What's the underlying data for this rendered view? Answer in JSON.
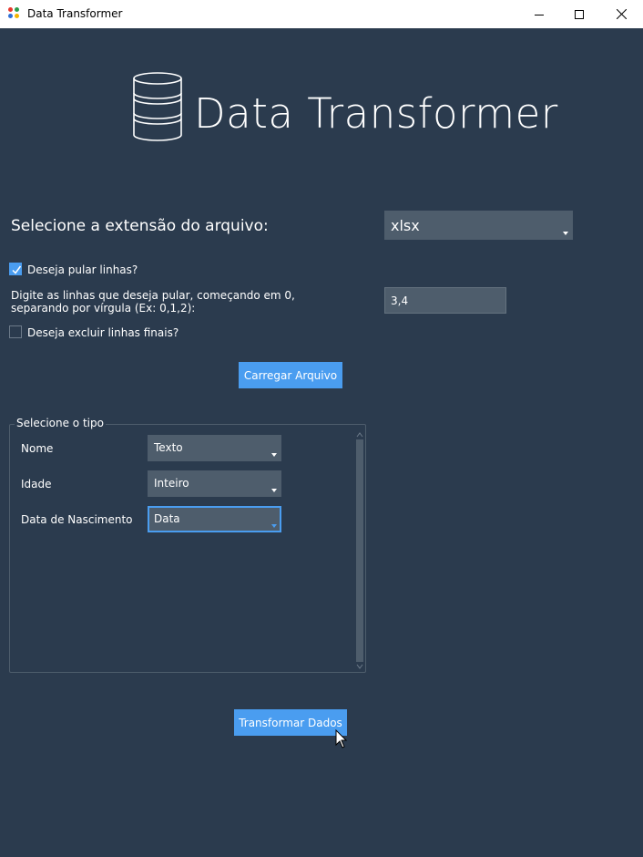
{
  "window": {
    "title": "Data Transformer",
    "minimize_icon": "minimize-icon",
    "maximize_icon": "maximize-icon",
    "close_icon": "close-icon"
  },
  "logo": {
    "icon": "database-icon",
    "title": "Data Transformer"
  },
  "extension": {
    "label": "Selecione a extensão do arquivo:",
    "selected": "xlsx"
  },
  "skip_lines": {
    "label": "Deseja pular linhas?",
    "checked": true,
    "instruction_line1": "Digite as linhas que deseja pular, começando em 0,",
    "instruction_line2": "separando por vírgula (Ex: 0,1,2):",
    "value": "3,4"
  },
  "exclude_final": {
    "label": "Deseja excluir linhas finais?",
    "checked": false
  },
  "load_button": "Carregar Arquivo",
  "types_group": {
    "title": "Selecione o tipo",
    "rows": [
      {
        "name": "Nome",
        "type": "Texto"
      },
      {
        "name": "Idade",
        "type": "Inteiro"
      },
      {
        "name": "Data de Nascimento",
        "type": "Data"
      }
    ]
  },
  "transform_button": "Transformar Dados",
  "colors": {
    "background": "#2b3b4e",
    "field": "#4e5d6c",
    "accent": "#4a9df0"
  }
}
